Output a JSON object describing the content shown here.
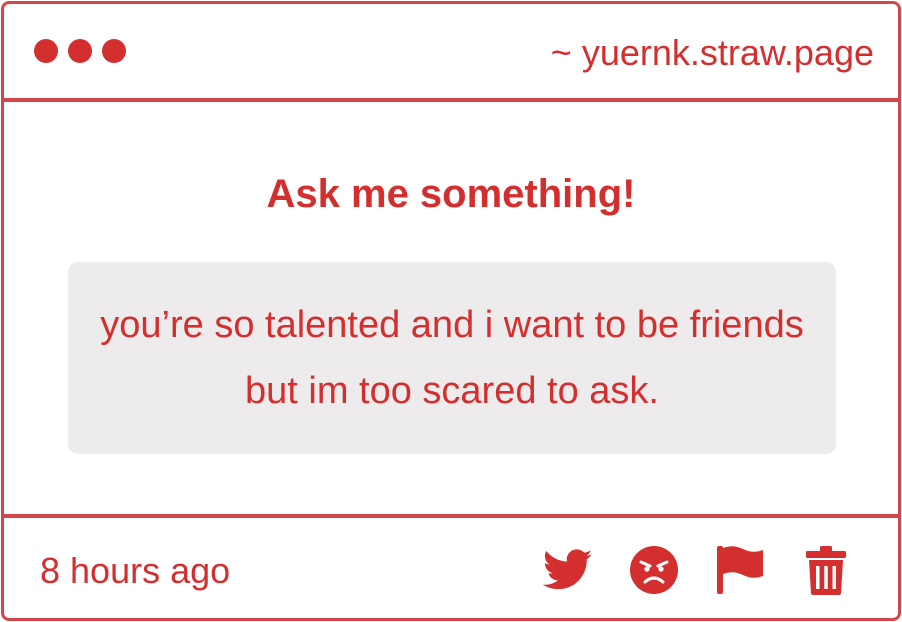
{
  "window": {
    "url": "~ yuernk.straw.page",
    "dot_color": "#d32f2f"
  },
  "main": {
    "heading": "Ask me something!",
    "message": "you’re so talented and i want to be friends but im too scared to ask."
  },
  "footer": {
    "timestamp": "8 hours ago",
    "actions": [
      {
        "icon": "twitter-icon"
      },
      {
        "icon": "angry-face-icon"
      },
      {
        "icon": "flag-icon"
      },
      {
        "icon": "trash-icon"
      }
    ]
  },
  "colors": {
    "accent": "#d32f2f",
    "border": "#d3474a",
    "message_bg": "#edebeb",
    "background": "#ffffff"
  }
}
